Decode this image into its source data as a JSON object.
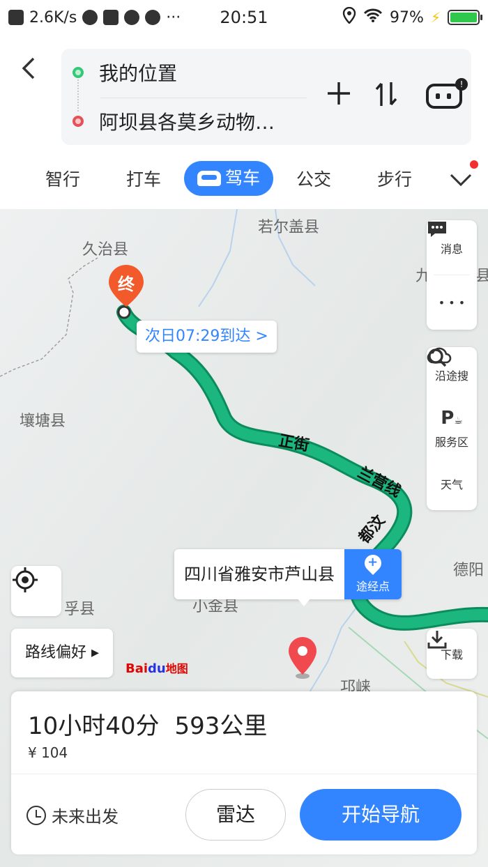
{
  "status_bar": {
    "net_speed": "2.6K/s",
    "time": "20:51",
    "battery": "97%"
  },
  "route_input": {
    "origin": "我的位置",
    "destination": "阿坝县各莫乡动物…"
  },
  "mode_tabs": [
    {
      "label": "智行",
      "active": false
    },
    {
      "label": "打车",
      "active": false
    },
    {
      "label": "驾车",
      "active": true
    },
    {
      "label": "公交",
      "active": false
    },
    {
      "label": "步行",
      "active": false
    }
  ],
  "map": {
    "place_labels": {
      "ruoergai": "若尔盖县",
      "jiuzhi": "久治县",
      "rangtang": "壤塘县",
      "deyang": "德阳",
      "xiaojin": "小金县",
      "fuxian": "孚县",
      "qionglai": "邛崃",
      "partial_right_top": "九",
      "partial_right_bottom": "县"
    },
    "road_labels": {
      "r1": "正街",
      "r2": "兰营线",
      "r3": "都汶"
    },
    "end_marker": "终",
    "eta": "次日07:29到达 >",
    "place_bubble": "四川省雅安市芦山县",
    "via_point": "途经点",
    "logo_bai": "Bai",
    "logo_du": "du",
    "logo_map": "地图"
  },
  "side_panel": {
    "messages": "消息",
    "more": "• • •",
    "search_along": "沿途搜",
    "service_area": "服务区",
    "weather": "天气",
    "download": "下载"
  },
  "route_pref": "路线偏好 ▸",
  "summary": {
    "duration": "10小时40分",
    "distance": "593公里",
    "cost": "¥ 104"
  },
  "actions": {
    "future_departure": "未来出发",
    "radar": "雷达",
    "start_navigation": "开始导航"
  },
  "colors": {
    "accent": "#3385ff",
    "route": "#1cb67f"
  }
}
